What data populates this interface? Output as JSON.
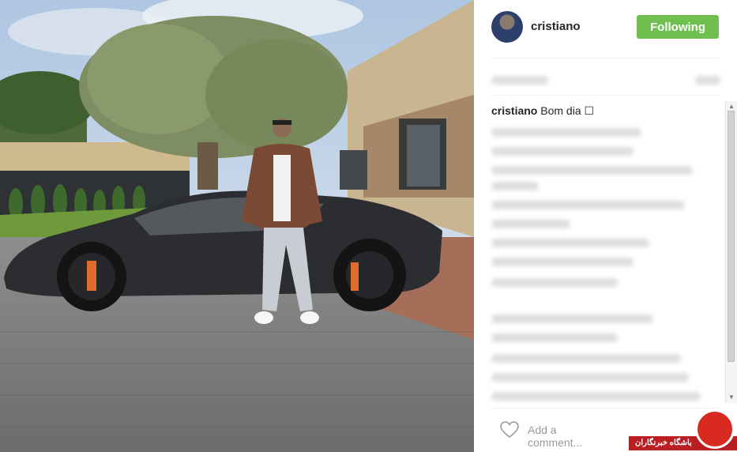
{
  "post": {
    "username": "cristiano",
    "follow_label": "Following",
    "caption_user": "cristiano",
    "caption_text": "Bom dia ☐",
    "comment_placeholder": "Add a comment...",
    "watermark": "باشگاه خبرنگاران"
  },
  "colors": {
    "follow_button": "#70c050",
    "watermark_red": "#b91e22"
  },
  "icons": [
    "heart-icon",
    "scroll-up-icon",
    "scroll-down-icon"
  ]
}
